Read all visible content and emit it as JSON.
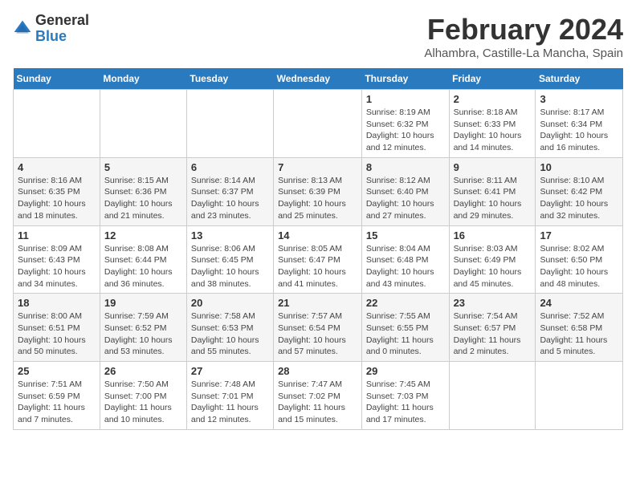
{
  "header": {
    "logo_general": "General",
    "logo_blue": "Blue",
    "month_title": "February 2024",
    "subtitle": "Alhambra, Castille-La Mancha, Spain"
  },
  "weekdays": [
    "Sunday",
    "Monday",
    "Tuesday",
    "Wednesday",
    "Thursday",
    "Friday",
    "Saturday"
  ],
  "weeks": [
    [
      {
        "day": "",
        "info": ""
      },
      {
        "day": "",
        "info": ""
      },
      {
        "day": "",
        "info": ""
      },
      {
        "day": "",
        "info": ""
      },
      {
        "day": "1",
        "info": "Sunrise: 8:19 AM\nSunset: 6:32 PM\nDaylight: 10 hours\nand 12 minutes."
      },
      {
        "day": "2",
        "info": "Sunrise: 8:18 AM\nSunset: 6:33 PM\nDaylight: 10 hours\nand 14 minutes."
      },
      {
        "day": "3",
        "info": "Sunrise: 8:17 AM\nSunset: 6:34 PM\nDaylight: 10 hours\nand 16 minutes."
      }
    ],
    [
      {
        "day": "4",
        "info": "Sunrise: 8:16 AM\nSunset: 6:35 PM\nDaylight: 10 hours\nand 18 minutes."
      },
      {
        "day": "5",
        "info": "Sunrise: 8:15 AM\nSunset: 6:36 PM\nDaylight: 10 hours\nand 21 minutes."
      },
      {
        "day": "6",
        "info": "Sunrise: 8:14 AM\nSunset: 6:37 PM\nDaylight: 10 hours\nand 23 minutes."
      },
      {
        "day": "7",
        "info": "Sunrise: 8:13 AM\nSunset: 6:39 PM\nDaylight: 10 hours\nand 25 minutes."
      },
      {
        "day": "8",
        "info": "Sunrise: 8:12 AM\nSunset: 6:40 PM\nDaylight: 10 hours\nand 27 minutes."
      },
      {
        "day": "9",
        "info": "Sunrise: 8:11 AM\nSunset: 6:41 PM\nDaylight: 10 hours\nand 29 minutes."
      },
      {
        "day": "10",
        "info": "Sunrise: 8:10 AM\nSunset: 6:42 PM\nDaylight: 10 hours\nand 32 minutes."
      }
    ],
    [
      {
        "day": "11",
        "info": "Sunrise: 8:09 AM\nSunset: 6:43 PM\nDaylight: 10 hours\nand 34 minutes."
      },
      {
        "day": "12",
        "info": "Sunrise: 8:08 AM\nSunset: 6:44 PM\nDaylight: 10 hours\nand 36 minutes."
      },
      {
        "day": "13",
        "info": "Sunrise: 8:06 AM\nSunset: 6:45 PM\nDaylight: 10 hours\nand 38 minutes."
      },
      {
        "day": "14",
        "info": "Sunrise: 8:05 AM\nSunset: 6:47 PM\nDaylight: 10 hours\nand 41 minutes."
      },
      {
        "day": "15",
        "info": "Sunrise: 8:04 AM\nSunset: 6:48 PM\nDaylight: 10 hours\nand 43 minutes."
      },
      {
        "day": "16",
        "info": "Sunrise: 8:03 AM\nSunset: 6:49 PM\nDaylight: 10 hours\nand 45 minutes."
      },
      {
        "day": "17",
        "info": "Sunrise: 8:02 AM\nSunset: 6:50 PM\nDaylight: 10 hours\nand 48 minutes."
      }
    ],
    [
      {
        "day": "18",
        "info": "Sunrise: 8:00 AM\nSunset: 6:51 PM\nDaylight: 10 hours\nand 50 minutes."
      },
      {
        "day": "19",
        "info": "Sunrise: 7:59 AM\nSunset: 6:52 PM\nDaylight: 10 hours\nand 53 minutes."
      },
      {
        "day": "20",
        "info": "Sunrise: 7:58 AM\nSunset: 6:53 PM\nDaylight: 10 hours\nand 55 minutes."
      },
      {
        "day": "21",
        "info": "Sunrise: 7:57 AM\nSunset: 6:54 PM\nDaylight: 10 hours\nand 57 minutes."
      },
      {
        "day": "22",
        "info": "Sunrise: 7:55 AM\nSunset: 6:55 PM\nDaylight: 11 hours\nand 0 minutes."
      },
      {
        "day": "23",
        "info": "Sunrise: 7:54 AM\nSunset: 6:57 PM\nDaylight: 11 hours\nand 2 minutes."
      },
      {
        "day": "24",
        "info": "Sunrise: 7:52 AM\nSunset: 6:58 PM\nDaylight: 11 hours\nand 5 minutes."
      }
    ],
    [
      {
        "day": "25",
        "info": "Sunrise: 7:51 AM\nSunset: 6:59 PM\nDaylight: 11 hours\nand 7 minutes."
      },
      {
        "day": "26",
        "info": "Sunrise: 7:50 AM\nSunset: 7:00 PM\nDaylight: 11 hours\nand 10 minutes."
      },
      {
        "day": "27",
        "info": "Sunrise: 7:48 AM\nSunset: 7:01 PM\nDaylight: 11 hours\nand 12 minutes."
      },
      {
        "day": "28",
        "info": "Sunrise: 7:47 AM\nSunset: 7:02 PM\nDaylight: 11 hours\nand 15 minutes."
      },
      {
        "day": "29",
        "info": "Sunrise: 7:45 AM\nSunset: 7:03 PM\nDaylight: 11 hours\nand 17 minutes."
      },
      {
        "day": "",
        "info": ""
      },
      {
        "day": "",
        "info": ""
      }
    ]
  ]
}
